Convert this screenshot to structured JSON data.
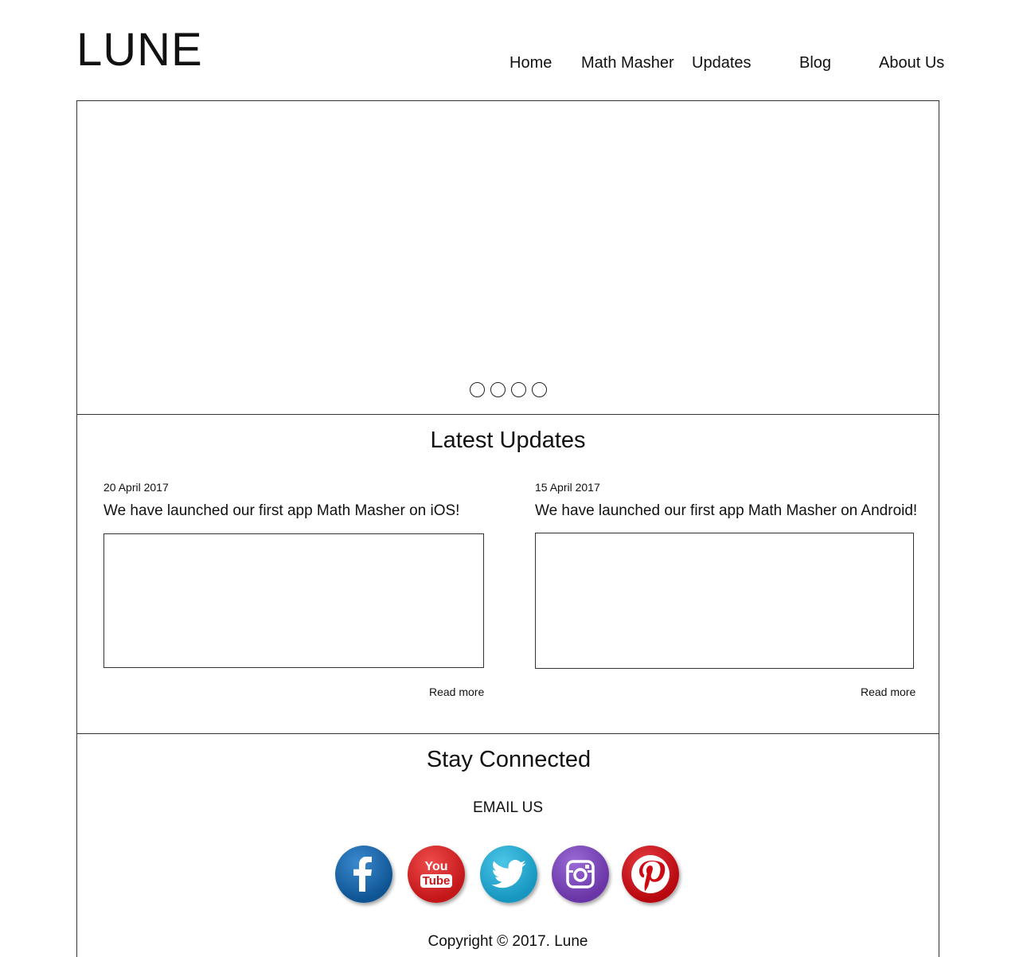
{
  "brand": {
    "logo": "LUNE"
  },
  "nav": [
    {
      "label": "Home"
    },
    {
      "label": "Math Masher"
    },
    {
      "label": "Updates"
    },
    {
      "label": "Blog"
    },
    {
      "label": "About Us"
    }
  ],
  "hero": {
    "slide_count": 4
  },
  "updates": {
    "title": "Latest Updates",
    "posts": [
      {
        "date": "20 April 2017",
        "headline": "We have launched our first app Math Masher on iOS!",
        "read_more": "Read more"
      },
      {
        "date": "15 April 2017",
        "headline": "We have launched our first app Math Masher on Android!",
        "read_more": "Read more"
      }
    ]
  },
  "connect": {
    "title": "Stay Connected",
    "email_label": "EMAIL US",
    "socials": [
      {
        "name": "facebook",
        "icon": "facebook-icon",
        "color": "#1565a8"
      },
      {
        "name": "youtube",
        "icon": "youtube-icon",
        "color": "#d41f1f",
        "text_top": "You",
        "text_bottom": "Tube"
      },
      {
        "name": "twitter",
        "icon": "twitter-icon",
        "color": "#1ea7cf"
      },
      {
        "name": "instagram",
        "icon": "instagram-icon",
        "color": "#7a45b5"
      },
      {
        "name": "pinterest",
        "icon": "pinterest-icon",
        "color": "#cc0a14"
      }
    ]
  },
  "footer": {
    "copyright": "Copyright © 2017. Lune"
  }
}
